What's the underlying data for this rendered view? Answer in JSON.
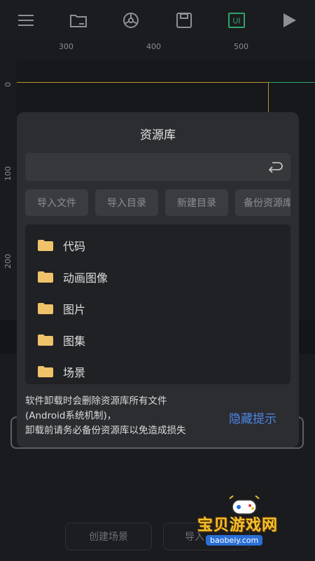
{
  "toolbar": {
    "icons": [
      "menu-icon",
      "folder-icon",
      "settings-wheel-icon",
      "save-icon",
      "ui-icon",
      "play-icon"
    ],
    "ui_label": "UI",
    "accent": "#2fa36b"
  },
  "ruler": {
    "top_ticks": [
      "300",
      "400",
      "500"
    ],
    "left_ticks": [
      "0",
      "100",
      "200"
    ]
  },
  "modal": {
    "title": "资源库",
    "path": "",
    "actions": [
      "导入文件",
      "导入目录",
      "新建目录",
      "备份资源库"
    ],
    "folders": [
      "代码",
      "动画图像",
      "图片",
      "图集",
      "场景"
    ],
    "warning_lines": [
      "软件卸载时会删除资源库所有文件",
      "(Android系统机制)，",
      "卸载前请务必备份资源库以免造成损失"
    ],
    "hide_tip": "隐藏提示",
    "link_color": "#4d86e6",
    "folder_color": "#f0c36a"
  },
  "bottom": {
    "create_scene": "创建场景",
    "import_partial": "导入"
  },
  "watermark": {
    "title": "宝贝游戏网",
    "url": "baobeiy.com"
  }
}
